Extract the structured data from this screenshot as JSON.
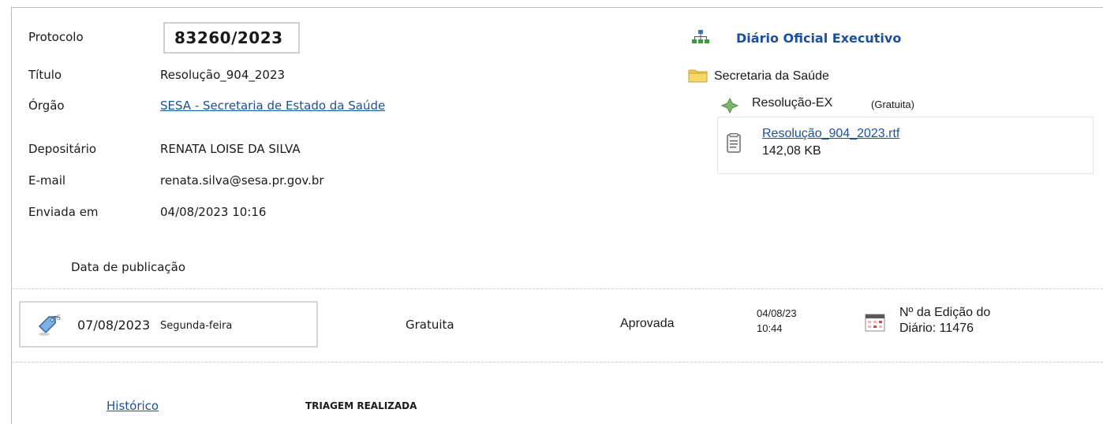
{
  "protocol": {
    "label": "Protocolo",
    "value": "83260/2023"
  },
  "fields": [
    {
      "label": "Título",
      "value": "Resolução_904_2023"
    },
    {
      "label": "Órgão",
      "value": "SESA - Secretaria de Estado da Saúde"
    },
    {
      "label": "Depositário",
      "value": "RENATA LOISE DA SILVA"
    },
    {
      "label": "E-mail",
      "value": "renata.silva@sesa.pr.gov.br"
    },
    {
      "label": "Enviada em",
      "value": "04/08/2023 10:16"
    }
  ],
  "tree": {
    "root": "Diário Oficial Executivo",
    "folder": "Secretaria da Saúde",
    "type_label": "Resolução-EX",
    "type_note": "(Gratuita)",
    "file_name": "Resolução_904_2023.rtf",
    "file_size": "142,08 KB"
  },
  "publication": {
    "section_label": "Data de publicação",
    "date": "07/08/2023",
    "weekday": "Segunda-feira",
    "charge": "Gratuita",
    "status": "Aprovada",
    "status_date": "04/08/23",
    "status_time": "10:44",
    "edition_line1": "Nº da Edição do",
    "edition_line2": "Diário: 11476"
  },
  "history": {
    "link": "Histórico",
    "status": "TRIAGEM REALIZADA"
  },
  "icons": [
    "org-chart-icon",
    "folder-icon",
    "diamond-icon",
    "document-icon",
    "date-tag-icon",
    "calendar-icon"
  ]
}
